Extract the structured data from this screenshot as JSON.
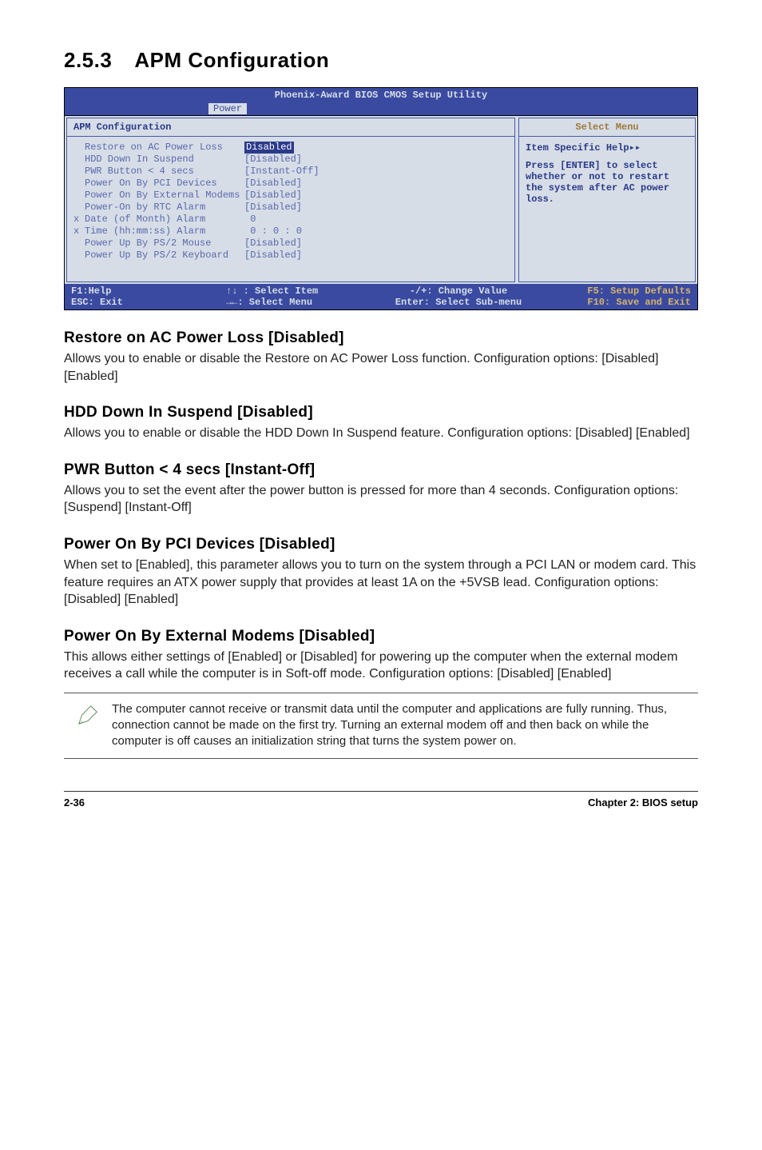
{
  "section": {
    "number": "2.5.3",
    "title": "APM Configuration"
  },
  "bios": {
    "window_title": "Phoenix-Award BIOS CMOS Setup Utility",
    "menu_active": "Power",
    "left_title": "APM Configuration",
    "right_title": "Select Menu",
    "rows": [
      {
        "lead": "",
        "label": "Restore on AC Power Loss",
        "value": "Disabled",
        "selected": true
      },
      {
        "lead": "",
        "label": "HDD Down In Suspend",
        "value": "[Disabled]"
      },
      {
        "lead": "",
        "label": "PWR Button < 4 secs",
        "value": "[Instant-Off]"
      },
      {
        "lead": "",
        "label": "Power On By PCI Devices",
        "value": "[Disabled]"
      },
      {
        "lead": "",
        "label": "Power On By External Modems",
        "value": "[Disabled]"
      },
      {
        "lead": "",
        "label": "Power-On by RTC Alarm",
        "value": "[Disabled]"
      },
      {
        "lead": "x",
        "label": "Date (of Month) Alarm",
        "value": " 0"
      },
      {
        "lead": "x",
        "label": "Time (hh:mm:ss) Alarm",
        "value": " 0 : 0 : 0"
      },
      {
        "lead": "",
        "label": "Power Up By PS/2 Mouse",
        "value": "[Disabled]"
      },
      {
        "lead": "",
        "label": "Power Up By PS/2 Keyboard",
        "value": "[Disabled]"
      }
    ],
    "help": {
      "title": "Item Specific Help",
      "body": "Press [ENTER] to select whether or not to restart the system after AC power loss."
    },
    "legend": {
      "l1a": "F1:Help",
      "l1b": "↑↓ : Select Item",
      "l1c": "-/+: Change Value",
      "l1d": "F5: Setup Defaults",
      "l2a": "ESC: Exit",
      "l2b": "→←: Select Menu",
      "l2c": "Enter: Select Sub-menu",
      "l2d": "F10: Save and Exit"
    }
  },
  "subs": {
    "s1": {
      "h": "Restore on AC Power Loss [Disabled]",
      "p": "Allows you to enable or disable the Restore on AC Power Loss function. Configuration options: [Disabled] [Enabled]"
    },
    "s2": {
      "h": "HDD Down In Suspend [Disabled]",
      "p": "Allows you to enable or disable the HDD Down In Suspend feature. Configuration options: [Disabled] [Enabled]"
    },
    "s3": {
      "h": "PWR Button < 4 secs [Instant-Off]",
      "p": "Allows you to set the event after the power button is pressed for more than 4 seconds. Configuration options: [Suspend] [Instant-Off]"
    },
    "s4": {
      "h": "Power On By PCI Devices [Disabled]",
      "p": "When set to [Enabled], this parameter allows you to turn on the system through a PCI LAN or modem card. This feature requires an ATX power supply that provides at least 1A on the +5VSB lead. Configuration options: [Disabled] [Enabled]"
    },
    "s5": {
      "h": "Power On By External Modems [Disabled]",
      "p": "This allows either settings of [Enabled] or [Disabled] for powering up the computer when the external modem receives a call while the computer is in Soft-off mode. Configuration options: [Disabled] [Enabled]"
    }
  },
  "note": "The computer cannot receive or transmit data until the computer and applications are fully running. Thus, connection cannot be made on the first try. Turning an external modem off and then back on while the computer is off causes an initialization string that turns the system power on.",
  "footer": {
    "left": "2-36",
    "right": "Chapter 2: BIOS setup"
  }
}
